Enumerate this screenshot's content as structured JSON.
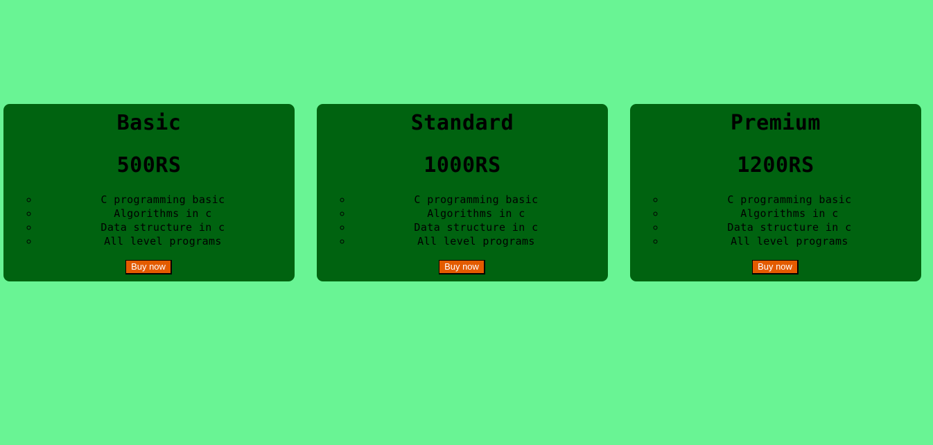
{
  "colors": {
    "page_background": "#69f494",
    "card_background": "#006310",
    "button_background": "#e35b00",
    "button_text": "#ffffff",
    "text": "#000000"
  },
  "plans": [
    {
      "name": "Basic",
      "price": "500RS",
      "features": [
        "C programming basic",
        "Algorithms in c",
        "Data structure in c",
        "All level programs"
      ],
      "button_label": "Buy now"
    },
    {
      "name": "Standard",
      "price": "1000RS",
      "features": [
        "C programming basic",
        "Algorithms in c",
        "Data structure in c",
        "All level programs"
      ],
      "button_label": "Buy now"
    },
    {
      "name": "Premium",
      "price": "1200RS",
      "features": [
        "C programming basic",
        "Algorithms in c",
        "Data structure in c",
        "All level programs"
      ],
      "button_label": "Buy now"
    }
  ]
}
